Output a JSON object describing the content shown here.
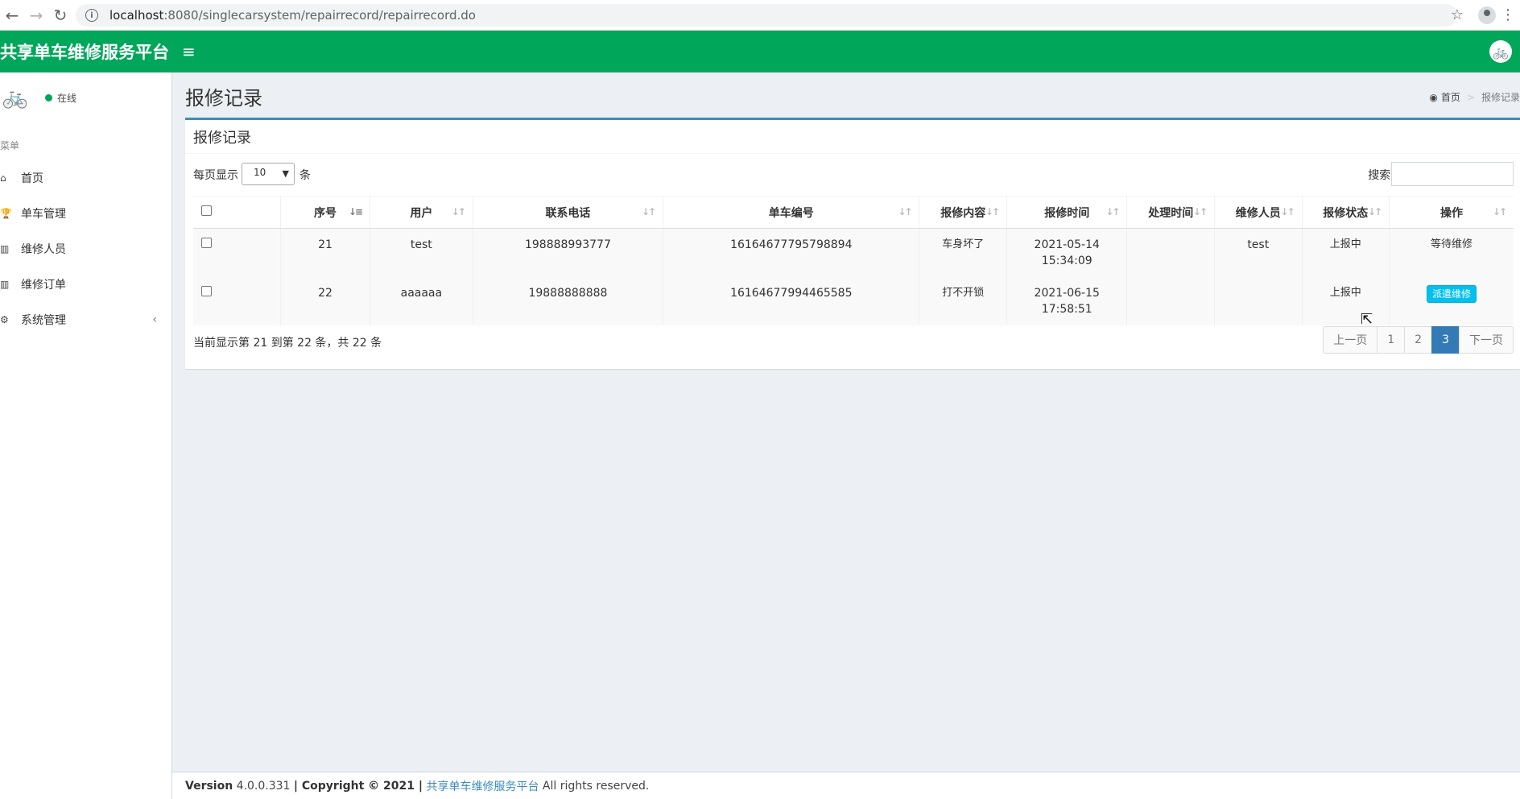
{
  "browser": {
    "url_host": "localhost",
    "url_path": ":8080/singlecarsystem/repairrecord/repairrecord.do"
  },
  "header": {
    "logo": "共享单车维修服务平台",
    "menu_toggle": "≡"
  },
  "sidebar": {
    "status": "在线",
    "menu_header": "菜单",
    "items": [
      {
        "label": "首页",
        "icon": "home-icon"
      },
      {
        "label": "单车管理",
        "icon": "trophy-icon"
      },
      {
        "label": "维修人员",
        "icon": "bar-chart-icon"
      },
      {
        "label": "维修订单",
        "icon": "bar-chart-icon"
      },
      {
        "label": "系统管理",
        "icon": "gear-icon"
      }
    ]
  },
  "content": {
    "page_title": "报修记录",
    "breadcrumb": {
      "home": "首页",
      "current": "报修记录"
    }
  },
  "box": {
    "title": "报修记录",
    "length_label": "每页显示",
    "length_value": "10",
    "length_unit": "条",
    "search_label": "搜索:"
  },
  "table": {
    "columns": [
      "序号",
      "用户",
      "联系电话",
      "单车编号",
      "报修内容",
      "报修时间",
      "处理时间",
      "维修人员",
      "报修状态",
      "操作"
    ],
    "rows": [
      {
        "id": "21",
        "user": "test",
        "phone": "198888993777",
        "bike": "16164677795798894",
        "content": "车身坏了",
        "time1": "2021-05-14",
        "time2": "15:34:09",
        "handle_time": "",
        "worker": "test",
        "status": "上报中",
        "action": "等待维修"
      },
      {
        "id": "22",
        "user": "aaaaaa",
        "phone": "19888888888",
        "bike": "16164677994465585",
        "content": "打不开锁",
        "time1": "2021-06-15",
        "time2": "17:58:51",
        "handle_time": "",
        "worker": "",
        "status": "上报中",
        "action": "派遣维修"
      }
    ]
  },
  "pager": {
    "info": "当前显示第 21 到第 22 条，共 22 条",
    "prev": "上一页",
    "pages": [
      "1",
      "2",
      "3"
    ],
    "next": "下一页"
  },
  "footer": {
    "version_label": "Version",
    "version": "4.0.0.331",
    "copyright": "| Copyright © 2021 |",
    "brand": "共享单车维修服务平台",
    "rights": "All rights reserved."
  }
}
